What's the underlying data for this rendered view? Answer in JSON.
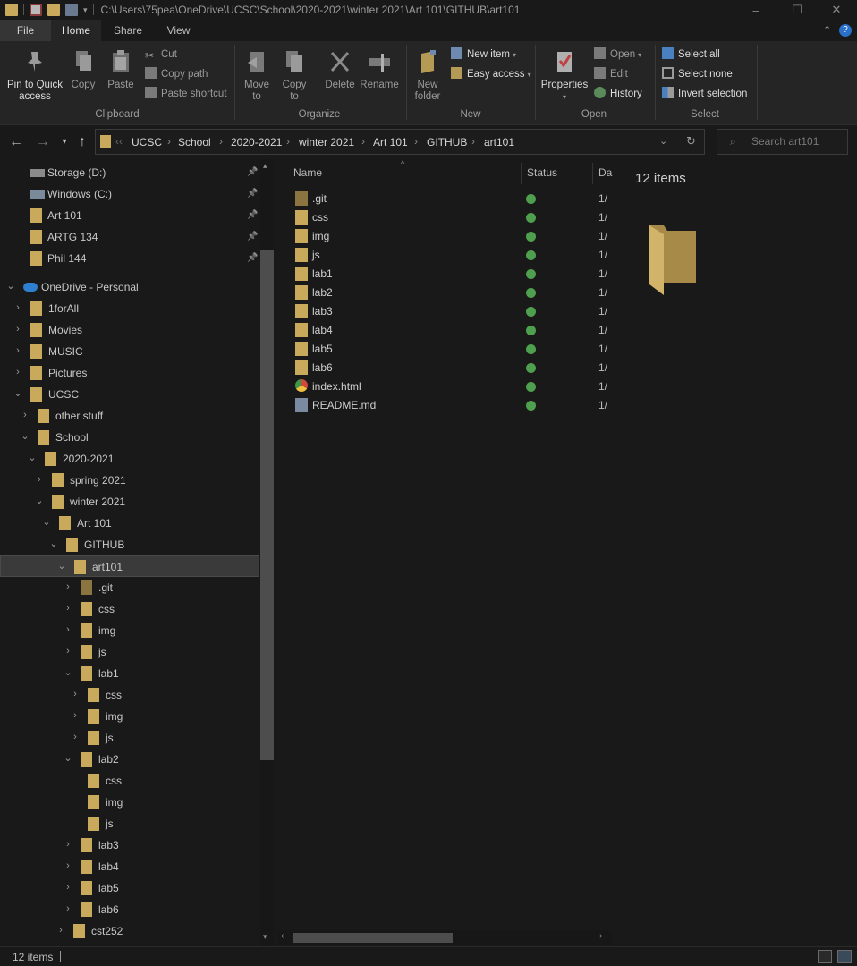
{
  "window": {
    "title_path": "C:\\Users\\75pea\\OneDrive\\UCSC\\School\\2020-2021\\winter 2021\\Art 101\\GITHUB\\art101",
    "minimize": "–",
    "maximize": "☐",
    "close": "✕"
  },
  "ribbon_tabs": [
    "File",
    "Home",
    "Share",
    "View"
  ],
  "ribbon": {
    "clipboard": {
      "label": "Clipboard",
      "pin_label": "Pin to Quick access",
      "copy_label": "Copy",
      "paste_label": "Paste",
      "cut_label": "Cut",
      "copy_path_label": "Copy path",
      "paste_shortcut_label": "Paste shortcut"
    },
    "organize": {
      "label": "Organize",
      "move_to_label": "Move to",
      "copy_to_label": "Copy to",
      "delete_label": "Delete",
      "rename_label": "Rename"
    },
    "new": {
      "label": "New",
      "new_folder_label": "New folder",
      "new_item_label": "New item",
      "easy_access_label": "Easy access"
    },
    "open": {
      "label": "Open",
      "properties_label": "Properties",
      "open_label": "Open",
      "edit_label": "Edit",
      "history_label": "History"
    },
    "select": {
      "label": "Select",
      "select_all_label": "Select all",
      "select_none_label": "Select none",
      "invert_label": "Invert selection"
    }
  },
  "breadcrumbs": [
    "UCSC",
    "School",
    "2020-2021",
    "winter 2021",
    "Art 101",
    "GITHUB",
    "art101"
  ],
  "search": {
    "placeholder": "Search art101"
  },
  "nav_tree": [
    {
      "label": "Storage (D:)",
      "icon": "drive-icon",
      "pinned": true
    },
    {
      "label": "Windows (C:)",
      "icon": "windows-drive-icon",
      "pinned": true
    },
    {
      "label": "Art 101",
      "icon": "folder-icon",
      "pinned": true
    },
    {
      "label": "ARTG 134",
      "icon": "folder-icon",
      "pinned": true
    },
    {
      "label": "Phil 144",
      "icon": "folder-icon",
      "pinned": true
    },
    {
      "label": "OneDrive - Personal",
      "icon": "cloud-icon",
      "expanded": true
    },
    {
      "label": "1forAll",
      "icon": "folder-icon"
    },
    {
      "label": "Movies",
      "icon": "folder-icon"
    },
    {
      "label": "MUSIC",
      "icon": "folder-icon"
    },
    {
      "label": "Pictures",
      "icon": "folder-icon"
    },
    {
      "label": "UCSC",
      "icon": "folder-icon",
      "expanded": true
    },
    {
      "label": "other stuff",
      "icon": "folder-icon"
    },
    {
      "label": "School",
      "icon": "folder-icon",
      "expanded": true
    },
    {
      "label": "2020-2021",
      "icon": "folder-icon",
      "expanded": true
    },
    {
      "label": "spring 2021",
      "icon": "folder-icon"
    },
    {
      "label": "winter 2021",
      "icon": "folder-icon",
      "expanded": true
    },
    {
      "label": "Art 101",
      "icon": "folder-icon",
      "expanded": true
    },
    {
      "label": "GITHUB",
      "icon": "folder-icon",
      "expanded": true
    },
    {
      "label": "art101",
      "icon": "folder-icon",
      "expanded": true,
      "selected": true
    },
    {
      "label": ".git",
      "icon": "folder-icon"
    },
    {
      "label": "css",
      "icon": "folder-icon"
    },
    {
      "label": "img",
      "icon": "folder-icon"
    },
    {
      "label": "js",
      "icon": "folder-icon"
    },
    {
      "label": "lab1",
      "icon": "folder-icon",
      "expanded": true
    },
    {
      "label": "css",
      "icon": "folder-icon"
    },
    {
      "label": "img",
      "icon": "folder-icon"
    },
    {
      "label": "js",
      "icon": "folder-icon"
    },
    {
      "label": "lab2",
      "icon": "folder-icon",
      "expanded": true
    },
    {
      "label": "css",
      "icon": "folder-icon"
    },
    {
      "label": "img",
      "icon": "folder-icon"
    },
    {
      "label": "js",
      "icon": "folder-icon"
    },
    {
      "label": "lab3",
      "icon": "folder-icon"
    },
    {
      "label": "lab4",
      "icon": "folder-icon"
    },
    {
      "label": "lab5",
      "icon": "folder-icon"
    },
    {
      "label": "lab6",
      "icon": "folder-icon"
    },
    {
      "label": "cst252",
      "icon": "folder-icon"
    }
  ],
  "columns": {
    "name": "Name",
    "status": "Status",
    "date": "Da"
  },
  "files": [
    {
      "name": ".git",
      "icon": "folder-icon",
      "date": "1/"
    },
    {
      "name": "css",
      "icon": "folder-icon",
      "date": "1/"
    },
    {
      "name": "img",
      "icon": "folder-icon",
      "date": "1/"
    },
    {
      "name": "js",
      "icon": "folder-icon",
      "date": "1/"
    },
    {
      "name": "lab1",
      "icon": "folder-icon",
      "date": "1/"
    },
    {
      "name": "lab2",
      "icon": "folder-icon",
      "date": "1/"
    },
    {
      "name": "lab3",
      "icon": "folder-icon",
      "date": "1/"
    },
    {
      "name": "lab4",
      "icon": "folder-icon",
      "date": "1/"
    },
    {
      "name": "lab5",
      "icon": "folder-icon",
      "date": "1/"
    },
    {
      "name": "lab6",
      "icon": "folder-icon",
      "date": "1/"
    },
    {
      "name": "index.html",
      "icon": "chrome-icon",
      "date": "1/"
    },
    {
      "name": "README.md",
      "icon": "notepad-icon",
      "date": "1/"
    }
  ],
  "preview": {
    "item_count": "12 items"
  },
  "status_bar": {
    "item_count": "12 items"
  },
  "colors": {
    "folder": "#c9a95c",
    "status_ok": "#4e9f4e",
    "background": "#191919",
    "ribbon": "#252525"
  }
}
